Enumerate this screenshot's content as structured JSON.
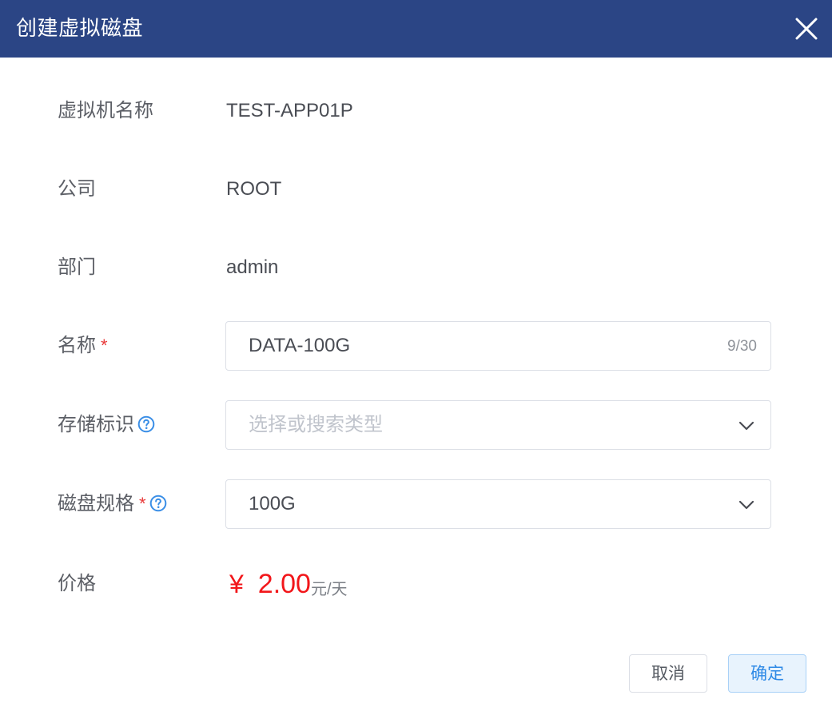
{
  "dialog": {
    "title": "创建虚拟磁盘",
    "close_icon": "close-icon"
  },
  "form": {
    "vm_name": {
      "label": "虚拟机名称",
      "value": "TEST-APP01P"
    },
    "company": {
      "label": "公司",
      "value": "ROOT"
    },
    "department": {
      "label": "部门",
      "value": "admin"
    },
    "name": {
      "label": "名称",
      "required_mark": "*",
      "value": "DATA-100G",
      "counter": "9/30"
    },
    "storage_tag": {
      "label": "存储标识",
      "help_icon": "question-circle-icon",
      "placeholder": "选择或搜索类型",
      "value": ""
    },
    "disk_spec": {
      "label": "磁盘规格",
      "required_mark": "*",
      "help_icon": "question-circle-icon",
      "value": "100G"
    },
    "price": {
      "label": "价格",
      "currency": "¥",
      "amount": "2.00",
      "unit": "元/天"
    }
  },
  "footer": {
    "cancel_label": "取消",
    "confirm_label": "确定"
  },
  "colors": {
    "header_bg": "#2b4585",
    "price": "#f2161a",
    "required": "#e83a3a",
    "help_icon": "#3a8ee6",
    "confirm_text": "#2f8ae6"
  }
}
